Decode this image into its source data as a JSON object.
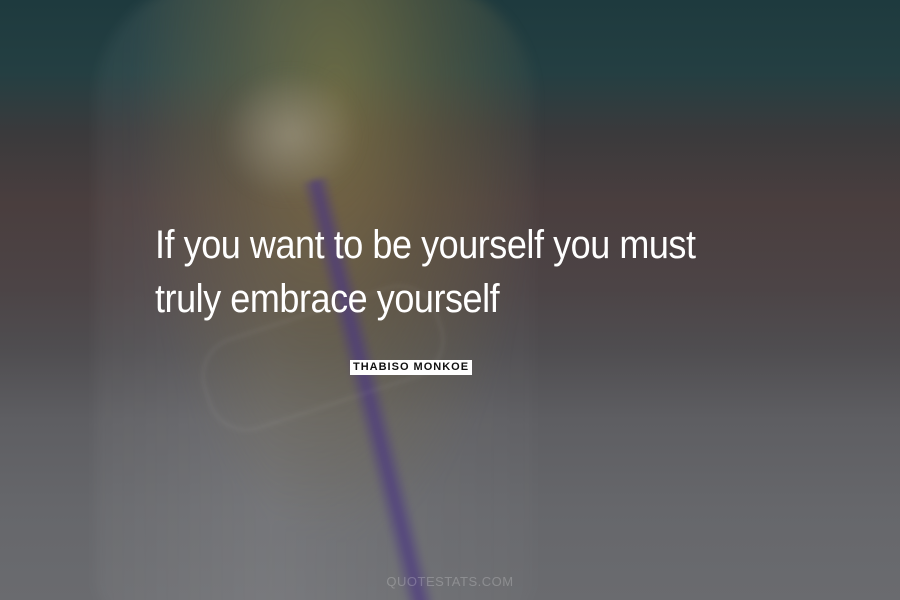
{
  "quote": {
    "line1": "If you want to be yourself you must",
    "line2": "truly embrace yourself"
  },
  "author": "THABISO MONKOE",
  "watermark": "QUOTESTATS.COM",
  "colors": {
    "text": "#ffffff",
    "author_bg": "#ffffff",
    "author_text": "#111111"
  }
}
